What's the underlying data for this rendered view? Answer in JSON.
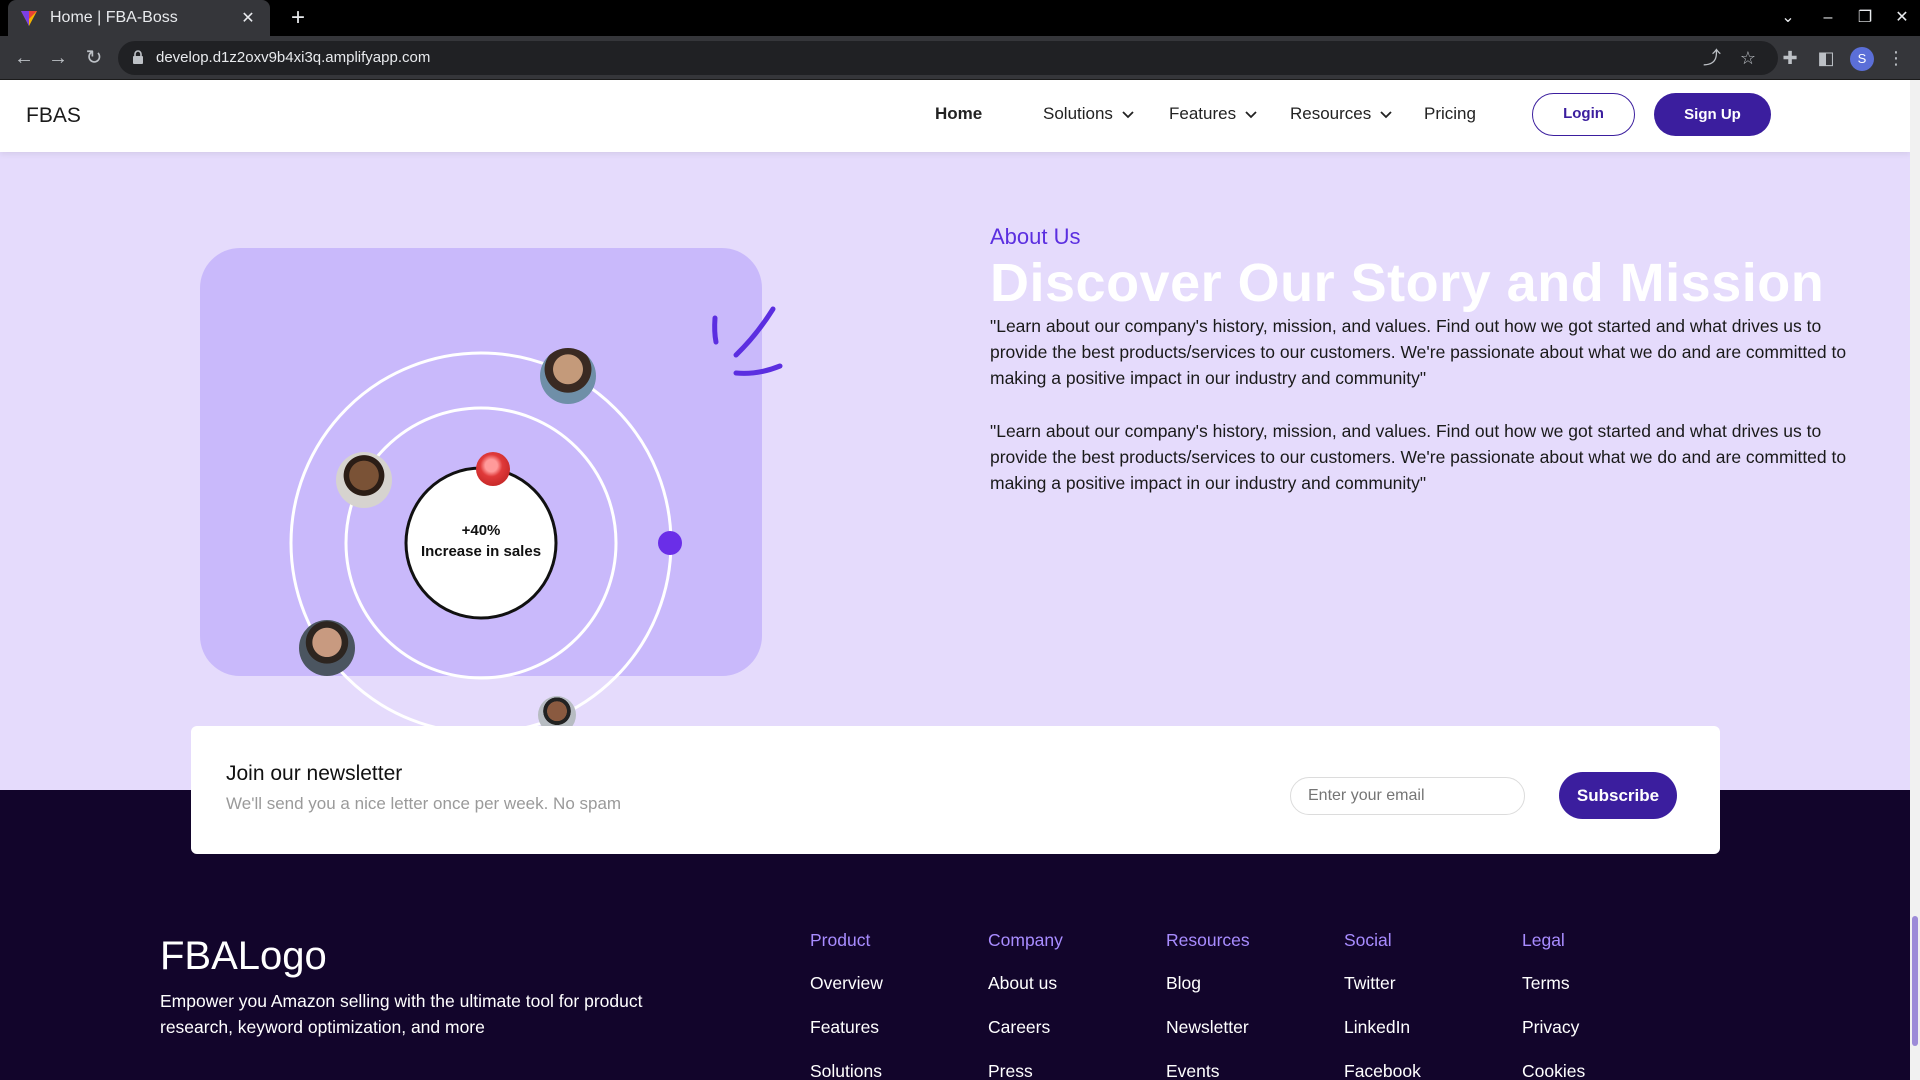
{
  "browser": {
    "tab_title": "Home | FBA-Boss",
    "url": "develop.d1z2oxv9b4xi3q.amplifyapp.com",
    "profile_initial": "S"
  },
  "nav": {
    "brand": "FBAS",
    "links": [
      {
        "label": "Home",
        "active": true
      },
      {
        "label": "Solutions",
        "dropdown": true
      },
      {
        "label": "Features",
        "dropdown": true
      },
      {
        "label": "Resources",
        "dropdown": true
      },
      {
        "label": "Pricing"
      }
    ],
    "login": "Login",
    "signup": "Sign Up"
  },
  "about": {
    "label": "About Us",
    "title": "Discover Our Story and Mission",
    "paragraphs": [
      "\"Learn about our company's history, mission, and values. Find out how we got started and what drives us to provide the best products/services to our customers. We're passionate about what we do and are committed to making a positive impact in our industry and community\"",
      "\"Learn about our company's history, mission, and values. Find out how we got started and what drives us to provide the best products/services to our customers. We're passionate about what we do and are committed to making a positive impact in our industry and community\""
    ],
    "stat_value": "+40%",
    "stat_label": "Increase in sales"
  },
  "newsletter": {
    "title": "Join our newsletter",
    "subtitle": "We'll send you a nice letter once per week. No spam",
    "placeholder": "Enter your email",
    "button": "Subscribe"
  },
  "footer": {
    "logo": "FBALogo",
    "tagline": "Empower you Amazon selling with the ultimate tool for product research, keyword optimization, and more",
    "columns": [
      {
        "heading": "Product",
        "links": [
          "Overview",
          "Features",
          "Solutions"
        ]
      },
      {
        "heading": "Company",
        "links": [
          "About us",
          "Careers",
          "Press"
        ]
      },
      {
        "heading": "Resources",
        "links": [
          "Blog",
          "Newsletter",
          "Events"
        ]
      },
      {
        "heading": "Social",
        "links": [
          "Twitter",
          "LinkedIn",
          "Facebook"
        ]
      },
      {
        "heading": "Legal",
        "links": [
          "Terms",
          "Privacy",
          "Cookies"
        ]
      }
    ]
  },
  "colors": {
    "brand_purple": "#3b1e9e",
    "accent_violet": "#5b2ee0",
    "section_bg": "#e5dbfc",
    "footer_bg": "#12052b"
  }
}
